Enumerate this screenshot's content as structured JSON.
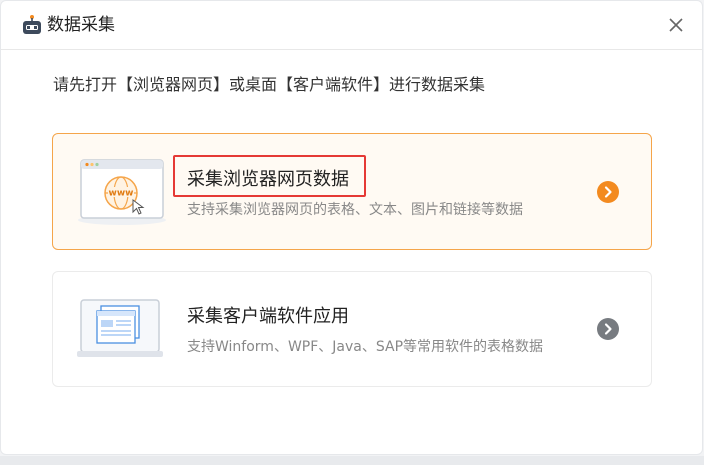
{
  "dialog": {
    "title": "数据采集",
    "prompt": "请先打开【浏览器网页】或桌面【客户端软件】进行数据采集"
  },
  "cards": [
    {
      "title": "采集浏览器网页数据",
      "description": "支持采集浏览器网页的表格、文本、图片和链接等数据",
      "illustration_text": "www"
    },
    {
      "title": "采集客户端软件应用",
      "description": "支持Winform、WPF、Java、SAP等常用软件的表格数据"
    }
  ],
  "colors": {
    "accent": "#f38a1f",
    "active_border": "#f5a54a",
    "highlight": "#e53935",
    "arrow_inactive": "#777b80"
  }
}
